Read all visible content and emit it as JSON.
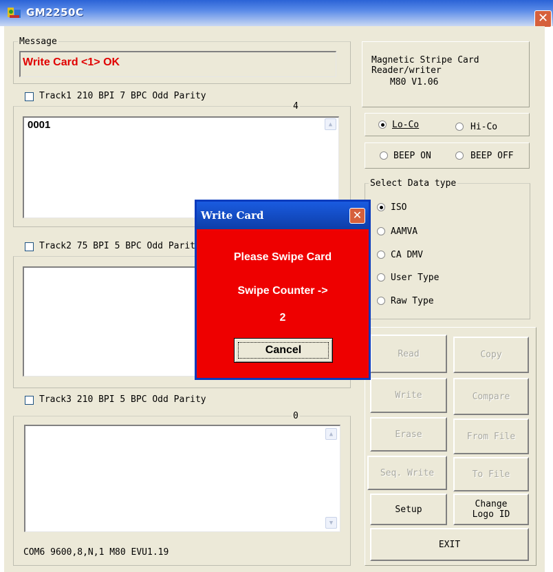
{
  "window": {
    "title": "GM2250C",
    "close_glyph": "✕"
  },
  "message": {
    "group_title": "Message",
    "text": "Write Card <1> OK"
  },
  "tracks": [
    {
      "label": "Track1 210 BPI 7 BPC Odd Parity",
      "count": "4",
      "data": "0001"
    },
    {
      "label": "Track2 75 BPI 5 BPC Odd Parity",
      "count": "",
      "data": ""
    },
    {
      "label": "Track3 210 BPI 5 BPC Odd Parity",
      "count": "0",
      "data": ""
    }
  ],
  "device_info": {
    "line1": "Magnetic Stripe Card",
    "line2": "Reader/writer",
    "line3": "M80  V1.06"
  },
  "coercivity": {
    "lo_co": "Lo-Co",
    "hi_co": "Hi-Co",
    "selected": "Lo-Co"
  },
  "beep": {
    "on": "BEEP ON",
    "off": "BEEP OFF"
  },
  "data_type": {
    "group_title": "Select Data type",
    "options": [
      "ISO",
      "AAMVA",
      "CA DMV",
      "User Type",
      "Raw Type"
    ],
    "selected": "ISO"
  },
  "buttons": {
    "read": "Read",
    "copy": "Copy",
    "write": "Write",
    "compare": "Compare",
    "erase": "Erase",
    "from_file": "From File",
    "seq_write": "Seq. Write",
    "to_file": "To File",
    "setup": "Setup",
    "change_logo_line1": "Change",
    "change_logo_line2": "Logo ID",
    "exit": "EXIT"
  },
  "status_bar": "COM6 9600,8,N,1  M80 EVU1.19",
  "dialog": {
    "title": "Write Card",
    "line1": "Please Swipe Card",
    "line2": "Swipe Counter ->",
    "counter": "2",
    "cancel": "Cancel",
    "close_glyph": "✕"
  },
  "colors": {
    "dialog_bg": "#ee0000",
    "message_text": "#e00000",
    "titlebar": "#2b63d6"
  }
}
